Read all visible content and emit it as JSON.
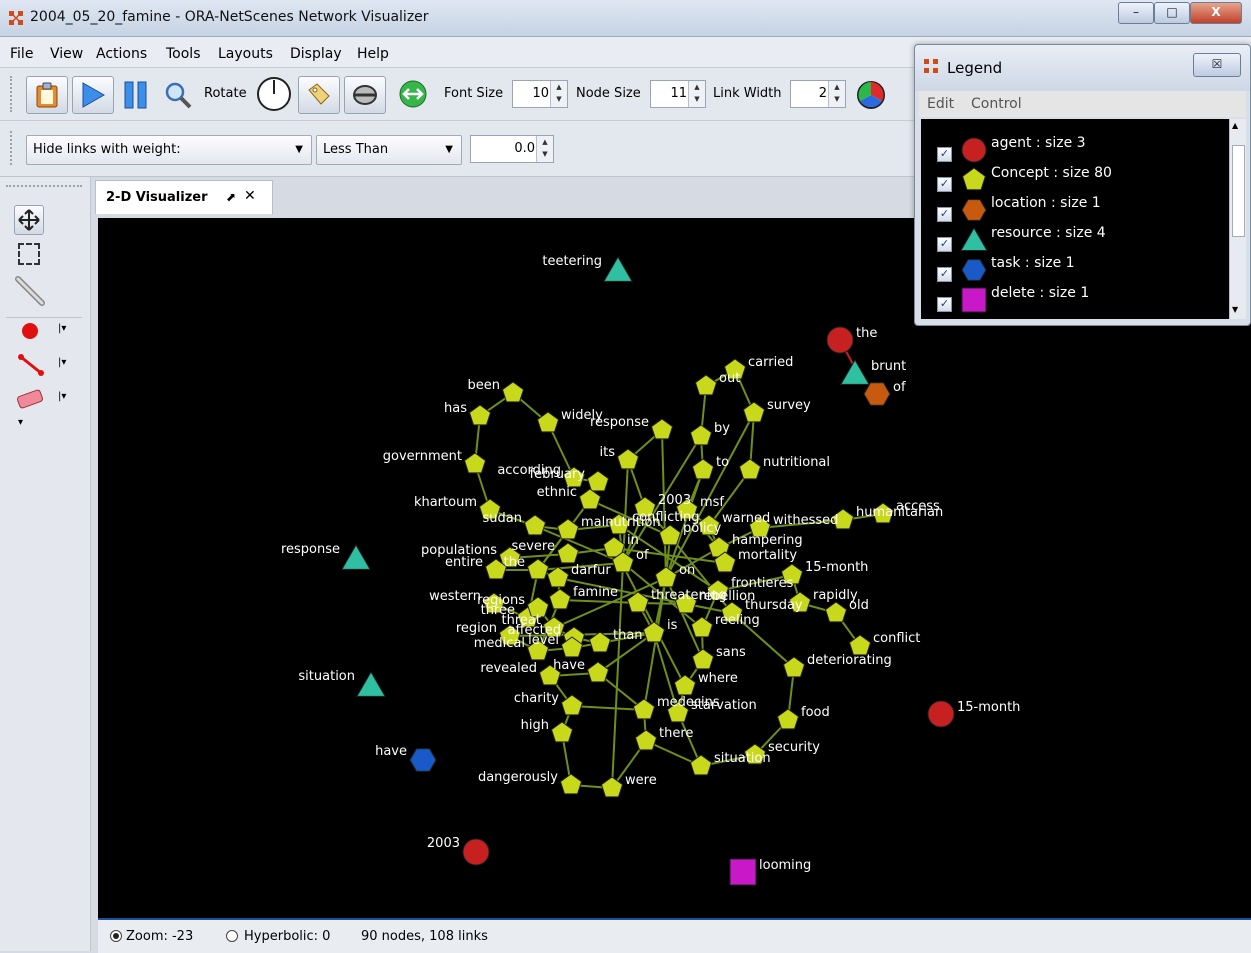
{
  "window": {
    "title": "2004_05_20_famine - ORA-NetScenes Network Visualizer",
    "minimize": "–",
    "maximize": "□",
    "close": "X"
  },
  "menu": [
    "File",
    "View",
    "Actions",
    "Tools",
    "Layouts",
    "Display",
    "Help"
  ],
  "toolbar": {
    "rotate_label": "Rotate",
    "font_size_label": "Font Size",
    "font_size_value": "10",
    "node_size_label": "Node Size",
    "node_size_value": "11",
    "link_width_label": "Link Width",
    "link_width_value": "2"
  },
  "filter": {
    "mode": "Hide links with weight:",
    "comparator": "Less Than",
    "threshold": "0.0"
  },
  "tab": {
    "label": "2-D Visualizer",
    "close": "✕",
    "pin": "⬈"
  },
  "status": {
    "zoom_label": "Zoom: -23",
    "hyperbolic_label": "Hyperbolic: 0",
    "summary": "90 nodes, 108 links"
  },
  "legend": {
    "title": "Legend",
    "close": "☒",
    "menu": [
      "Edit",
      "Control"
    ],
    "items": [
      {
        "label": "agent : size 3",
        "shape": "circle",
        "color": "#c62020"
      },
      {
        "label": "Concept : size 80",
        "shape": "pentagon",
        "color": "#c8d81a"
      },
      {
        "label": "location : size 1",
        "shape": "hexagon",
        "color": "#c85a10"
      },
      {
        "label": "resource : size 4",
        "shape": "triangle",
        "color": "#2ec0a0"
      },
      {
        "label": "task : size 1",
        "shape": "hexagon",
        "color": "#1a5ac8"
      },
      {
        "label": "delete : size 1",
        "shape": "square",
        "color": "#c818c8"
      }
    ]
  },
  "colors": {
    "agent": "#c62020",
    "concept": "#c8d81a",
    "location": "#c85a10",
    "resource": "#2ec0a0",
    "task": "#1a5ac8",
    "delete": "#c818c8",
    "link": "#6f8f1c"
  },
  "network": {
    "isolated": [
      {
        "label": "teetering",
        "type": "resource"
      },
      {
        "label": "response",
        "type": "resource"
      },
      {
        "label": "situation",
        "type": "resource"
      },
      {
        "label": "have",
        "type": "task"
      },
      {
        "label": "2003",
        "type": "agent"
      },
      {
        "label": "looming",
        "type": "delete"
      },
      {
        "label": "15-month",
        "type": "agent"
      },
      {
        "label": "the",
        "type": "agent"
      },
      {
        "label": "brunt",
        "type": "resource"
      },
      {
        "label": "of",
        "type": "location"
      }
    ],
    "concepts": [
      "carried",
      "out",
      "survey",
      "by",
      "to",
      "nutritional",
      "response",
      "its",
      "been",
      "has",
      "widely",
      "government",
      "according",
      "february",
      "ethnic",
      "2003",
      "khartoum",
      "sudan",
      "malnutrition",
      "conflicting",
      "msf",
      "warned",
      "withessed",
      "humanitarian",
      "access",
      "policy",
      "in",
      "hampering",
      "mortality",
      "populations",
      "severe",
      "entire",
      "the",
      "darfur",
      "of",
      "on",
      "frontieres",
      "15-month",
      "rapidly",
      "old",
      "western",
      "three",
      "regions",
      "famine",
      "threatening",
      "rebellion",
      "thursday",
      "reeling",
      "conflict",
      "region",
      "threat",
      "affected",
      "is",
      "medical",
      "level",
      "than",
      "sans",
      "where",
      "deteriorating",
      "revealed",
      "have",
      "charity",
      "medecins",
      "starvation",
      "food",
      "high",
      "there",
      "security",
      "situation",
      "dangerously",
      "were"
    ]
  }
}
